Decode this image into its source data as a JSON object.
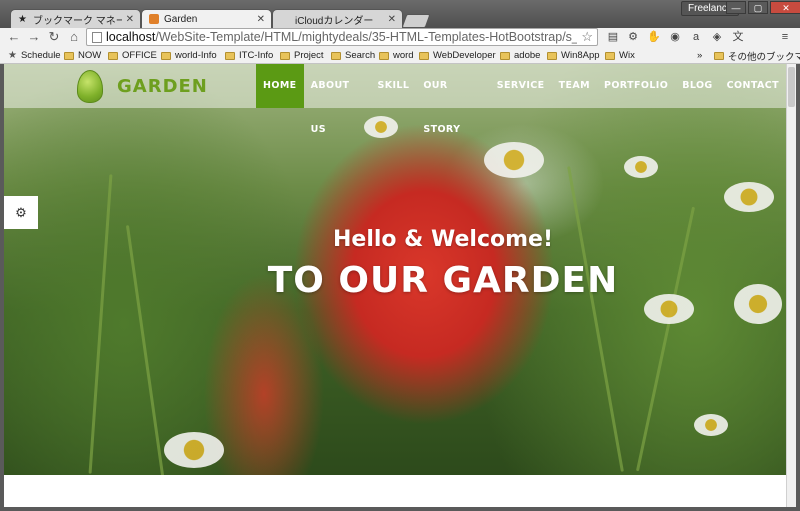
{
  "browser": {
    "tabs": [
      {
        "label": "ブックマーク マネージャ",
        "icon": "star-icon"
      },
      {
        "label": "Garden",
        "icon": "page-favicon"
      },
      {
        "label": "iCloudカレンダー",
        "icon": "apple-icon"
      }
    ],
    "profile": "Freelance",
    "url_host": "localhost",
    "url_path": "/WebSite-Template/HTML/mightydeals/35-HTML-Templates-HotBootstrap/s_gard",
    "bookmarks": [
      "Schedule",
      "NOW",
      "OFFICE",
      "world-Info",
      "ITC-Info",
      "Project",
      "Search",
      "word",
      "WebDeveloper",
      "adobe",
      "Win8App",
      "Wix"
    ],
    "bookmarks_overflow": "»",
    "other_bookmarks": "その他のブックマーク"
  },
  "site": {
    "logo": "GARDEN",
    "menu": [
      "HOME",
      "ABOUT US",
      "SKILL",
      "OUR STORY",
      "SERVICE",
      "TEAM",
      "PORTFOLIO",
      "BLOG",
      "CONTACT"
    ],
    "active_menu": "HOME",
    "hero_line1": "Hello & Welcome!",
    "hero_line2": "TO OUR GARDEN",
    "accent_color": "#5b9a14"
  }
}
